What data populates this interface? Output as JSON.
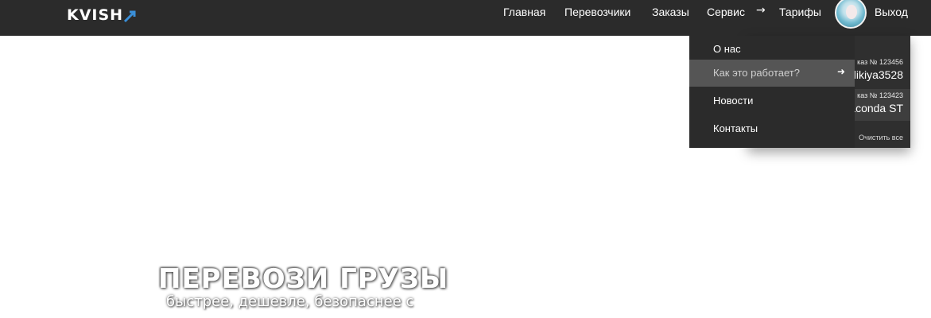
{
  "brand": {
    "logo_text": "KVISH"
  },
  "nav": {
    "home": "Главная",
    "carriers": "Перевозчики",
    "orders": "Заказы",
    "service": "Сервис",
    "tariffs": "Тарифы",
    "logout": "Выход"
  },
  "service_menu": {
    "items": [
      {
        "label": "О нас"
      },
      {
        "label": "Как это работает?"
      },
      {
        "label": "Новости"
      },
      {
        "label": "Контакты"
      }
    ],
    "active_index": 1
  },
  "notifications": {
    "items": [
      {
        "order": "каз № 123456",
        "name": "likiya3528"
      },
      {
        "order": "каз № 123423",
        "name": "aconda ST"
      }
    ],
    "clear_label": "Очистить все"
  },
  "hero": {
    "title": "ПЕРЕВОЗИ ГРУЗЫ",
    "subtitle": "быстрее, дешевле, безопаснее с"
  },
  "icons": {
    "service_arrow": "arrow-right-icon",
    "submenu_arrow": "arrow-right-icon"
  }
}
